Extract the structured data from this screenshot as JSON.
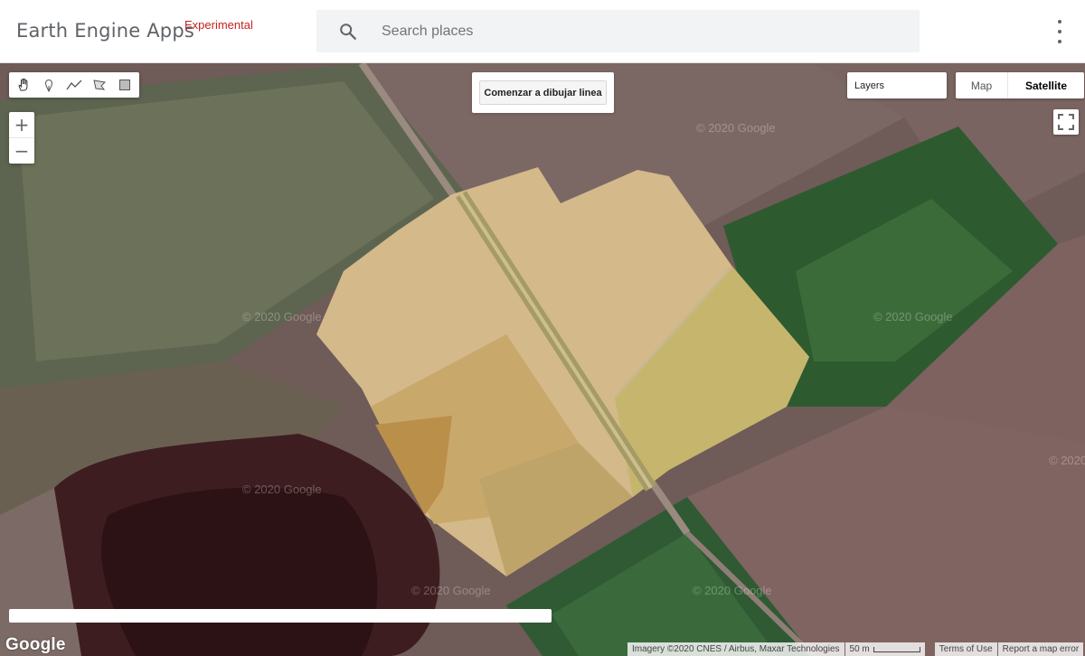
{
  "header": {
    "app_title": "Earth Engine Apps",
    "app_badge": "Experimental",
    "search_placeholder": "Search places",
    "search_value": ""
  },
  "map": {
    "drawing_tools": [
      {
        "name": "pan",
        "icon": "hand-icon"
      },
      {
        "name": "point",
        "icon": "marker-icon"
      },
      {
        "name": "line",
        "icon": "polyline-icon"
      },
      {
        "name": "polygon",
        "icon": "polygon-icon"
      },
      {
        "name": "rectangle",
        "icon": "rectangle-icon"
      }
    ],
    "zoom_in_label": "+",
    "zoom_out_label": "−",
    "draw_line_button": "Comenzar a dibujar linea",
    "layers_label": "Layers",
    "map_type_map": "Map",
    "map_type_satellite": "Satellite",
    "selected_map_type": "Satellite",
    "watermark_text": "© 2020 Google",
    "google_logo": "Google",
    "attribution": {
      "imagery": "Imagery ©2020 CNES / Airbus, Maxar Technologies",
      "scale": "50 m",
      "terms": "Terms of Use",
      "report": "Report a map error"
    },
    "colors": {
      "field_green": "#2d5a2e",
      "field_brown": "#7a6562",
      "water": "#3e1d20",
      "overlay_tan": "#d4b98a",
      "badge_red": "#c5221f"
    }
  }
}
